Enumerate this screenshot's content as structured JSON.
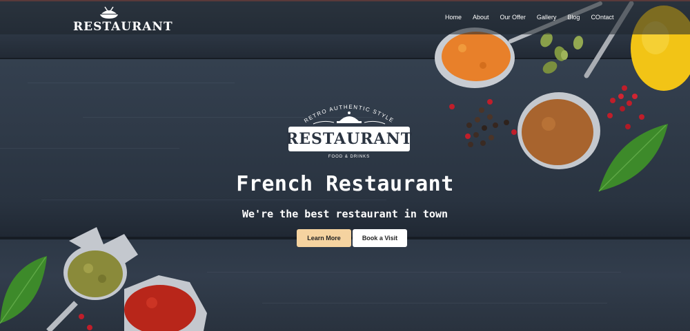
{
  "header": {
    "logo_text": "RESTAURANT",
    "nav": [
      "Home",
      "About",
      "Our Offer",
      "Gallery",
      "Blog",
      "COntact"
    ]
  },
  "hero": {
    "badge_arc_text": "RETRO AUTHENTIC STYLE",
    "badge_main": "RESTAURANT",
    "badge_sub": "FOOD & DRINKS",
    "title": "French Restaurant",
    "subtitle": "We're the best restaurant in town",
    "buttons": {
      "learn_more": "Learn More",
      "book_visit": "Book a Visit"
    }
  },
  "icons": [
    "dish-cloche-icon",
    "spoon-spice-icon",
    "leaf-icon",
    "lemon-icon",
    "peppercorn-icon"
  ],
  "colors": {
    "accent_button": "#f5d3a0",
    "wood_dark": "#2f3946",
    "turmeric": "#e8802a",
    "paprika": "#b8261a",
    "leaf_green": "#3d8a2a",
    "lemon": "#f2c416"
  }
}
